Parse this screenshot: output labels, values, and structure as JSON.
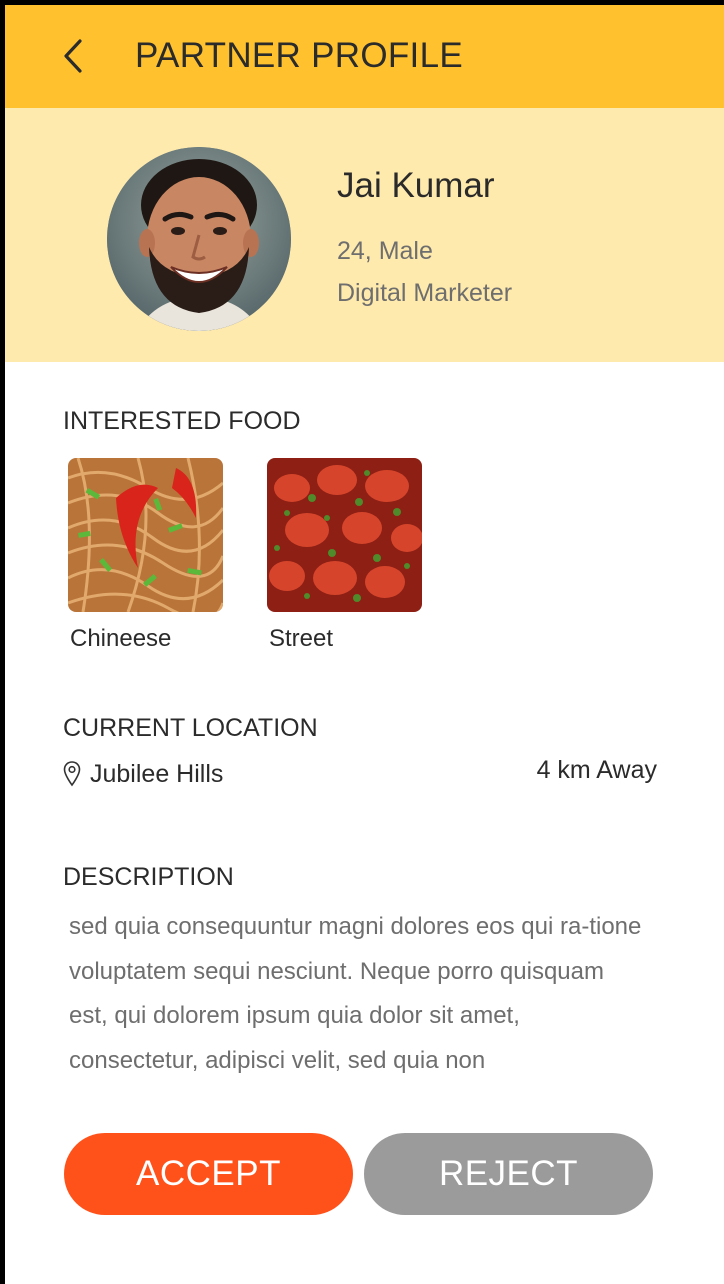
{
  "header": {
    "title": "PARTNER PROFILE",
    "back_icon": "chevron-left-icon"
  },
  "profile": {
    "name": "Jai Kumar",
    "age_gender": "24, Male",
    "occupation": "Digital Marketer"
  },
  "interested_food": {
    "title": "INTERESTED FOOD",
    "items": [
      {
        "label": "Chineese"
      },
      {
        "label": "Street"
      }
    ]
  },
  "location": {
    "title": "CURRENT LOCATION",
    "name": "Jubilee Hills",
    "distance": "4 km Away",
    "icon": "location-pin-icon"
  },
  "description": {
    "title": "DESCRIPTION",
    "text": "sed quia consequuntur magni dolores eos qui ra-tione voluptatem sequi nesciunt. Neque porro quisquam est, qui dolorem ipsum quia dolor sit amet, consectetur, adipisci velit, sed quia non"
  },
  "actions": {
    "accept_label": "ACCEPT",
    "reject_label": "REJECT"
  },
  "colors": {
    "header": "#FFC22E",
    "profile_band": "#FFEAAD",
    "accept": "#FF521B",
    "reject": "#9B9B9B"
  }
}
